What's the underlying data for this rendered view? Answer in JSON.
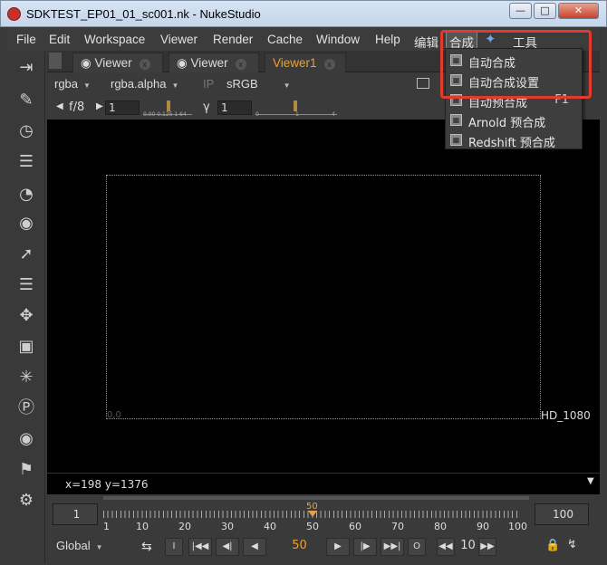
{
  "window": {
    "title": "SDKTEST_EP01_01_sc001.nk - NukeStudio",
    "minimize": "—",
    "maximize": "□",
    "close": "✕"
  },
  "menubar": [
    "File",
    "Edit",
    "Workspace",
    "Viewer",
    "Render",
    "Cache",
    "Window",
    "Help",
    "编辑",
    "合成",
    "工具"
  ],
  "tabs": [
    {
      "label": "Viewer",
      "active": false
    },
    {
      "label": "Viewer",
      "active": false
    },
    {
      "label": "Viewer1",
      "active": true
    }
  ],
  "viewer_controls": {
    "channels": "rgba",
    "alpha": "rgba.alpha",
    "ip": "IP",
    "lut": "sRGB",
    "fstop": "f/8",
    "gain": "1",
    "gamma_label": "γ",
    "gamma": "1",
    "gain_ticks": [
      "0.00",
      "0.125",
      "1",
      "64"
    ],
    "gamma_ticks": [
      "0",
      "1",
      "4"
    ]
  },
  "viewer": {
    "format": "HD_1080",
    "origin": "0,0",
    "coords": "x=198 y=1376"
  },
  "timeline": {
    "start": "1",
    "end": "100",
    "current": "50",
    "ticks": [
      "1",
      "10",
      "20",
      "30",
      "40",
      "50",
      "60",
      "70",
      "80",
      "90",
      "100"
    ]
  },
  "transport": {
    "scope": "Global",
    "frame": "50",
    "step": "10",
    "in_label": "I",
    "out_label": "O"
  },
  "dropdown_menu": {
    "items": [
      {
        "label": "自动合成",
        "shortcut": ""
      },
      {
        "label": "自动合成设置",
        "shortcut": ""
      },
      {
        "label": "自动预合成",
        "shortcut": "F1"
      },
      {
        "label": "Arnold 预合成",
        "shortcut": ""
      },
      {
        "label": "Redshift 预合成",
        "shortcut": ""
      }
    ]
  },
  "colors": {
    "accent": "#f0a030",
    "highlight": "#e23b2d"
  }
}
